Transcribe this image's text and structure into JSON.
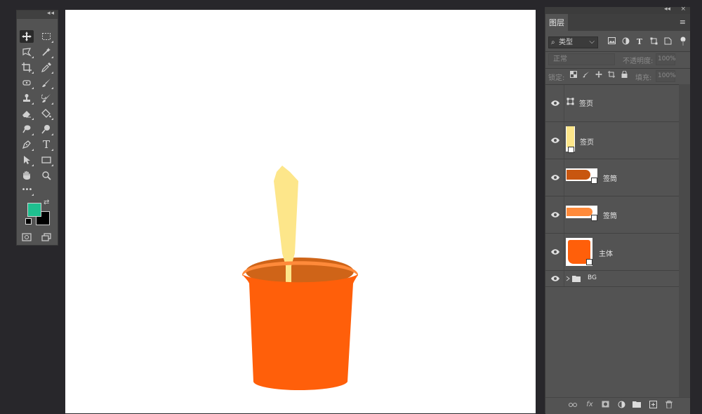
{
  "tools_panel": {
    "collapse_glyph": "◂◂",
    "close_glyph": "×",
    "tools": [
      "move-tool",
      "marquee-tool",
      "lasso-tool",
      "magic-wand-tool",
      "crop-tool",
      "eyedropper-tool",
      "healing-brush-tool",
      "brush-tool",
      "clone-stamp-tool",
      "history-brush-tool",
      "eraser-tool",
      "paint-bucket-tool",
      "smudge-tool",
      "dodge-tool",
      "pen-tool",
      "type-tool",
      "path-selection-tool",
      "rectangle-tool",
      "hand-tool",
      "zoom-tool",
      "more-tools"
    ],
    "type_tool_glyph": "T",
    "more_glyph": "•••",
    "foreground_color": "#1fbf8f",
    "background_color": "#000000",
    "swap_glyph": "⇄"
  },
  "canvas": {
    "background": "#ffffff",
    "artwork": {
      "cup_color": "#ff5f0a",
      "cup_rim_color": "#ff8a3a",
      "cup_inner_color": "#cf6418",
      "stick_color": "#fde68a"
    }
  },
  "layers_panel": {
    "collapse_glyph": "◂◂",
    "close_glyph": "×",
    "tab_label": "图层",
    "menu_glyph": "≡",
    "filter": {
      "kind_label": "类型",
      "search_glyph": "⌕",
      "chevron_glyph": "⌵",
      "icons": [
        "image-filter-icon",
        "adjustment-filter-icon",
        "type-filter-icon",
        "shape-filter-icon",
        "smart-object-filter-icon"
      ],
      "type_glyph": "T"
    },
    "blend": {
      "mode_label": "正常",
      "opacity_label": "不透明度:",
      "opacity_value": "100%"
    },
    "lock": {
      "lock_label": "锁定:",
      "fill_label": "填充:",
      "fill_value": "100%"
    },
    "layers": [
      {
        "name": "签页",
        "kind": "shape"
      },
      {
        "name": "签页",
        "kind": "smart",
        "thumb_color": "#fde68a"
      },
      {
        "name": "签筒",
        "kind": "smart",
        "thumb_color": "#c8560f"
      },
      {
        "name": "签筒",
        "kind": "smart",
        "thumb_color": "#ff8a3a"
      },
      {
        "name": "主体",
        "kind": "smart",
        "thumb_color": "#ff5f0a"
      },
      {
        "name": "BG",
        "kind": "group"
      }
    ],
    "bottom_icons": [
      "link-layers-icon",
      "fx-icon",
      "add-mask-icon",
      "adjustment-layer-icon",
      "new-group-icon",
      "new-layer-icon",
      "delete-layer-icon"
    ],
    "fx_label": "fx"
  }
}
